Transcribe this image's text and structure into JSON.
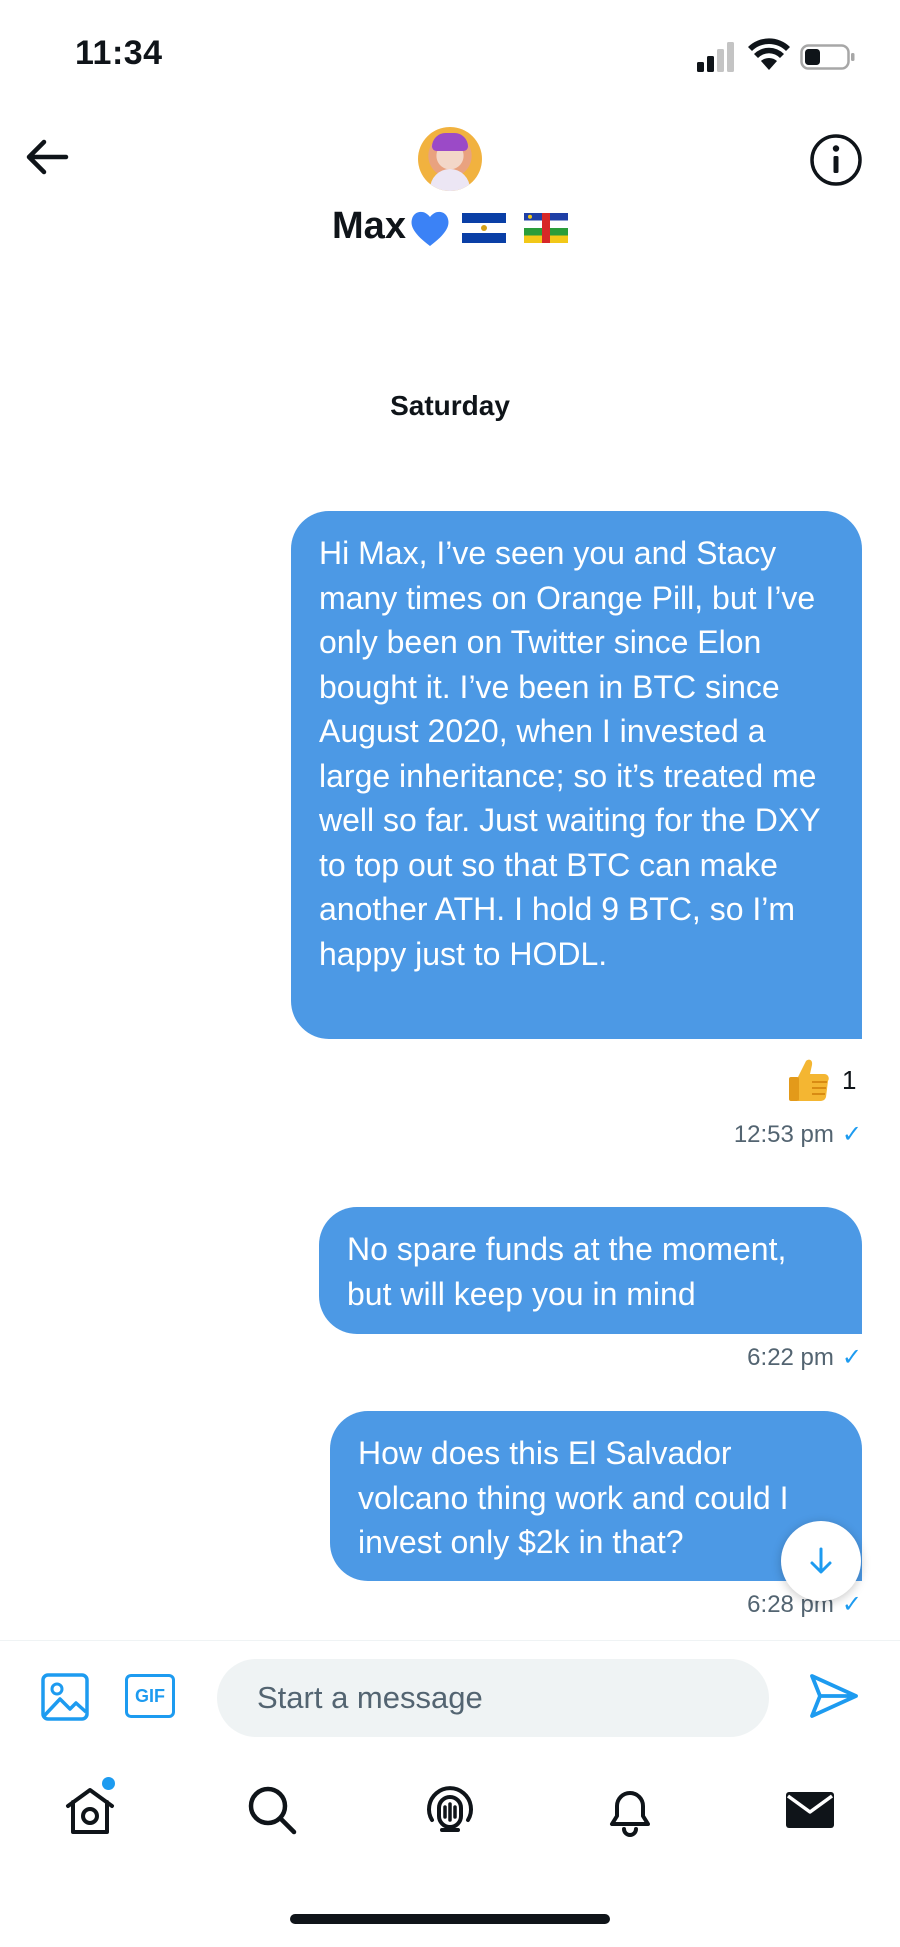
{
  "status_bar": {
    "time": "11:34",
    "signal_icon": "cellular-signal-icon",
    "wifi_icon": "wifi-icon",
    "battery_icon": "battery-icon"
  },
  "header": {
    "back_icon": "arrow-left-icon",
    "info_icon": "info-circle-icon",
    "contact_name": "Max",
    "name_emoji": [
      "blue-heart",
      "flag-el-salvador",
      "flag-central-african-republic"
    ]
  },
  "conversation": {
    "day_separator": "Saturday",
    "messages": [
      {
        "text": "Hi Max, I’ve seen you and Stacy many times on Orange Pill, but I’ve only been on Twitter since Elon bought it. I’ve been in BTC since August 2020, when I invested a large inheritance; so it’s treated me well so far. Just waiting for the DXY to top out so that BTC can make another ATH. I hold 9 BTC, so I’m happy just to HODL.",
        "reaction_count": "1",
        "reaction_icon": "thumbs-up-emoji",
        "time": "12:53 pm",
        "status": "✓"
      },
      {
        "text": "No spare funds at the moment, but will keep you in mind",
        "time": "6:22 pm",
        "status": "✓"
      },
      {
        "text": "How does this El Salvador volcano thing work and could I invest only $2k in that?",
        "time": "6:28 pm",
        "status": "✓"
      }
    ],
    "scroll_down_icon": "arrow-down-icon"
  },
  "composer": {
    "placeholder": "Start a message",
    "value": "",
    "gif_label": "GIF",
    "media_icon": "image-icon",
    "send_icon": "send-icon"
  },
  "bottom_nav": {
    "items": [
      "home-icon",
      "search-icon",
      "spaces-icon",
      "bell-icon",
      "mail-icon"
    ],
    "active": "mail-icon"
  },
  "colors": {
    "bubble": "#4c99e5",
    "accent": "#1d9bf0",
    "text": "#0f1419",
    "muted": "#536471",
    "input_bg": "#eff3f4"
  }
}
